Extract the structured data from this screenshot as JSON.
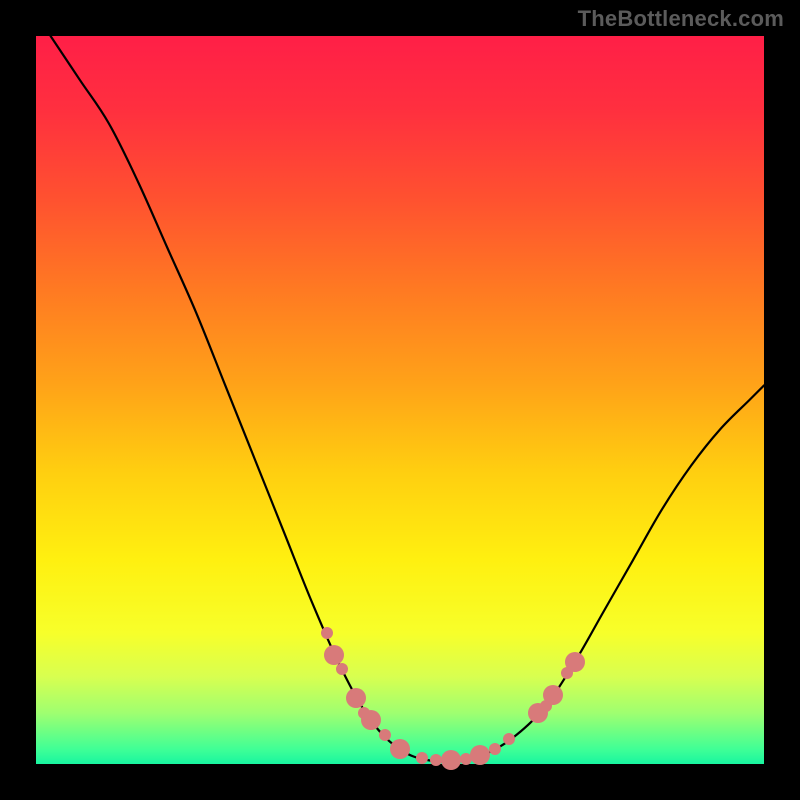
{
  "watermark": {
    "text": "TheBottleneck.com"
  },
  "chart_data": {
    "type": "line",
    "title": "",
    "xlabel": "",
    "ylabel": "",
    "xlim": [
      0,
      100
    ],
    "ylim": [
      0,
      100
    ],
    "grid": false,
    "legend": false,
    "curve": {
      "name": "bottleneck-curve",
      "points": [
        {
          "x": 2,
          "y": 100
        },
        {
          "x": 6,
          "y": 94
        },
        {
          "x": 10,
          "y": 88
        },
        {
          "x": 14,
          "y": 80
        },
        {
          "x": 18,
          "y": 71
        },
        {
          "x": 22,
          "y": 62
        },
        {
          "x": 26,
          "y": 52
        },
        {
          "x": 30,
          "y": 42
        },
        {
          "x": 34,
          "y": 32
        },
        {
          "x": 38,
          "y": 22
        },
        {
          "x": 42,
          "y": 13
        },
        {
          "x": 46,
          "y": 6
        },
        {
          "x": 50,
          "y": 2
        },
        {
          "x": 54,
          "y": 0.5
        },
        {
          "x": 58,
          "y": 0.5
        },
        {
          "x": 62,
          "y": 1.5
        },
        {
          "x": 66,
          "y": 4
        },
        {
          "x": 70,
          "y": 8
        },
        {
          "x": 74,
          "y": 14
        },
        {
          "x": 78,
          "y": 21
        },
        {
          "x": 82,
          "y": 28
        },
        {
          "x": 86,
          "y": 35
        },
        {
          "x": 90,
          "y": 41
        },
        {
          "x": 94,
          "y": 46
        },
        {
          "x": 98,
          "y": 50
        },
        {
          "x": 100,
          "y": 52
        }
      ]
    },
    "markers": {
      "name": "highlighted-points",
      "color": "#d87a7a",
      "radius_small": 6,
      "radius_large": 10,
      "points": [
        {
          "x": 40,
          "y": 18,
          "r": "small"
        },
        {
          "x": 41,
          "y": 15,
          "r": "large"
        },
        {
          "x": 42,
          "y": 13,
          "r": "small"
        },
        {
          "x": 44,
          "y": 9,
          "r": "large"
        },
        {
          "x": 45,
          "y": 7,
          "r": "small"
        },
        {
          "x": 46,
          "y": 6,
          "r": "large"
        },
        {
          "x": 48,
          "y": 4,
          "r": "small"
        },
        {
          "x": 50,
          "y": 2,
          "r": "large"
        },
        {
          "x": 53,
          "y": 0.8,
          "r": "small"
        },
        {
          "x": 55,
          "y": 0.5,
          "r": "small"
        },
        {
          "x": 57,
          "y": 0.5,
          "r": "large"
        },
        {
          "x": 59,
          "y": 0.7,
          "r": "small"
        },
        {
          "x": 61,
          "y": 1.2,
          "r": "large"
        },
        {
          "x": 63,
          "y": 2,
          "r": "small"
        },
        {
          "x": 65,
          "y": 3.5,
          "r": "small"
        },
        {
          "x": 69,
          "y": 7,
          "r": "large"
        },
        {
          "x": 70,
          "y": 8,
          "r": "small"
        },
        {
          "x": 71,
          "y": 9.5,
          "r": "large"
        },
        {
          "x": 73,
          "y": 12.5,
          "r": "small"
        },
        {
          "x": 74,
          "y": 14,
          "r": "large"
        }
      ]
    },
    "gradient_stops": [
      {
        "offset": 0.0,
        "color": "#ff1f47"
      },
      {
        "offset": 0.1,
        "color": "#ff2f3f"
      },
      {
        "offset": 0.22,
        "color": "#ff5030"
      },
      {
        "offset": 0.35,
        "color": "#ff7a22"
      },
      {
        "offset": 0.48,
        "color": "#ffa318"
      },
      {
        "offset": 0.6,
        "color": "#ffcf10"
      },
      {
        "offset": 0.72,
        "color": "#fff010"
      },
      {
        "offset": 0.82,
        "color": "#f7ff2a"
      },
      {
        "offset": 0.88,
        "color": "#d8ff50"
      },
      {
        "offset": 0.93,
        "color": "#9fff70"
      },
      {
        "offset": 0.98,
        "color": "#3fff96"
      },
      {
        "offset": 1.0,
        "color": "#18f5a0"
      }
    ]
  }
}
